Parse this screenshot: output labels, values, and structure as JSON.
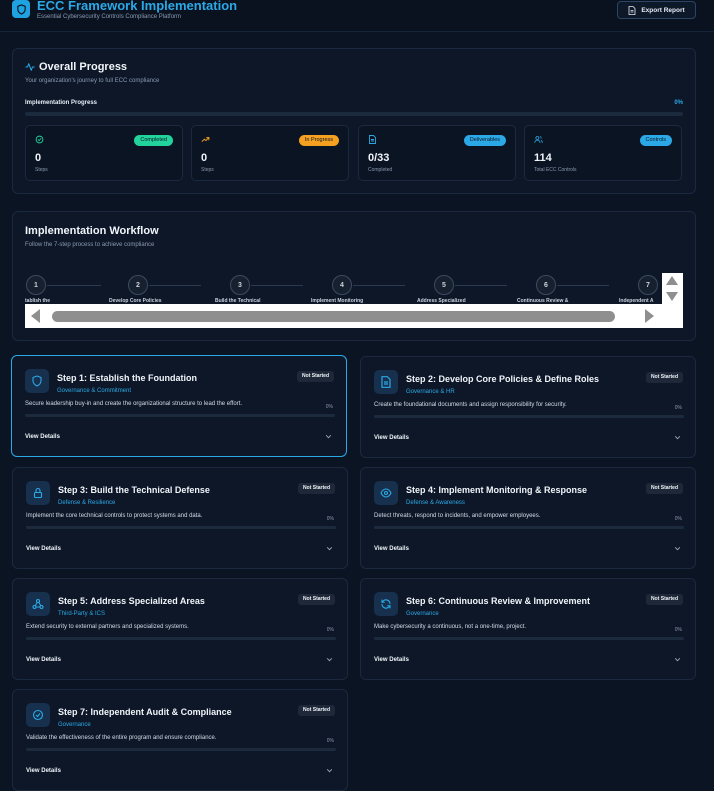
{
  "colors": {
    "accent": "#2ba9e6",
    "background": "#0b1423",
    "completed": "#22d39c",
    "in_progress": "#f5a020",
    "deliverables": "#2ba9e6",
    "controls": "#2ba9e6"
  },
  "header": {
    "title": "ECC Framework Implementation",
    "subtitle": "Essential Cybersecurity Controls Compliance Platform",
    "logo_icon": "shield-icon",
    "export_label": "Export Report",
    "export_icon": "document-icon"
  },
  "overall": {
    "title": "Overall Progress",
    "title_icon": "activity-icon",
    "subtitle": "Your organization's journey to full ECC compliance",
    "progress_label": "Implementation Progress",
    "progress_percent": "0%",
    "progress_value": 0,
    "stats": [
      {
        "icon": "check-circle-icon",
        "badge": "Completed",
        "value": "0",
        "label": "Steps"
      },
      {
        "icon": "trending-up-icon",
        "badge": "In Progress",
        "value": "0",
        "label": "Steps"
      },
      {
        "icon": "file-icon",
        "badge": "Deliverables",
        "value": "0/33",
        "label": "Completed"
      },
      {
        "icon": "users-icon",
        "badge": "Controls",
        "value": "114",
        "label": "Total ECC Controls"
      }
    ]
  },
  "workflow": {
    "title": "Implementation Workflow",
    "subtitle": "Follow the 7-step process to achieve compliance",
    "nodes": [
      {
        "number": "1",
        "label": "tablish the"
      },
      {
        "number": "2",
        "label": "Develop Core Policies"
      },
      {
        "number": "3",
        "label": "Build the Technical"
      },
      {
        "number": "4",
        "label": "Implement Monitoring"
      },
      {
        "number": "5",
        "label": "Address Specialized"
      },
      {
        "number": "6",
        "label": "Continuous Review &"
      },
      {
        "number": "7",
        "label": "Independent A"
      }
    ]
  },
  "steps": [
    {
      "icon": "shield-icon",
      "title": "Step 1: Establish the Foundation",
      "category": "Governance & Commitment",
      "status": "Not Started",
      "description": "Secure leadership buy-in and create the organizational structure to lead the effort.",
      "percent": "0%",
      "progress": 0,
      "details_label": "View Details"
    },
    {
      "icon": "document-icon",
      "title": "Step 2: Develop Core Policies & Define Roles",
      "category": "Governance & HR",
      "status": "Not Started",
      "description": "Create the foundational documents and assign responsibility for security.",
      "percent": "0%",
      "progress": 0,
      "details_label": "View Details"
    },
    {
      "icon": "lock-icon",
      "title": "Step 3: Build the Technical Defense",
      "category": "Defense & Resilience",
      "status": "Not Started",
      "description": "Implement the core technical controls to protect systems and data.",
      "percent": "0%",
      "progress": 0,
      "details_label": "View Details"
    },
    {
      "icon": "eye-icon",
      "title": "Step 4: Implement Monitoring & Response",
      "category": "Defense & Awareness",
      "status": "Not Started",
      "description": "Detect threats, respond to incidents, and empower employees.",
      "percent": "0%",
      "progress": 0,
      "details_label": "View Details"
    },
    {
      "icon": "network-icon",
      "title": "Step 5: Address Specialized Areas",
      "category": "Third-Party & ICS",
      "status": "Not Started",
      "description": "Extend security to external partners and specialized systems.",
      "percent": "0%",
      "progress": 0,
      "details_label": "View Details"
    },
    {
      "icon": "refresh-icon",
      "title": "Step 6: Continuous Review & Improvement",
      "category": "Governance",
      "status": "Not Started",
      "description": "Make cybersecurity a continuous, not a one-time, project.",
      "percent": "0%",
      "progress": 0,
      "details_label": "View Details"
    },
    {
      "icon": "check-badge-icon",
      "title": "Step 7: Independent Audit & Compliance",
      "category": "Governance",
      "status": "Not Started",
      "description": "Validate the effectiveness of the entire program and ensure compliance.",
      "percent": "0%",
      "progress": 0,
      "details_label": "View Details"
    }
  ]
}
